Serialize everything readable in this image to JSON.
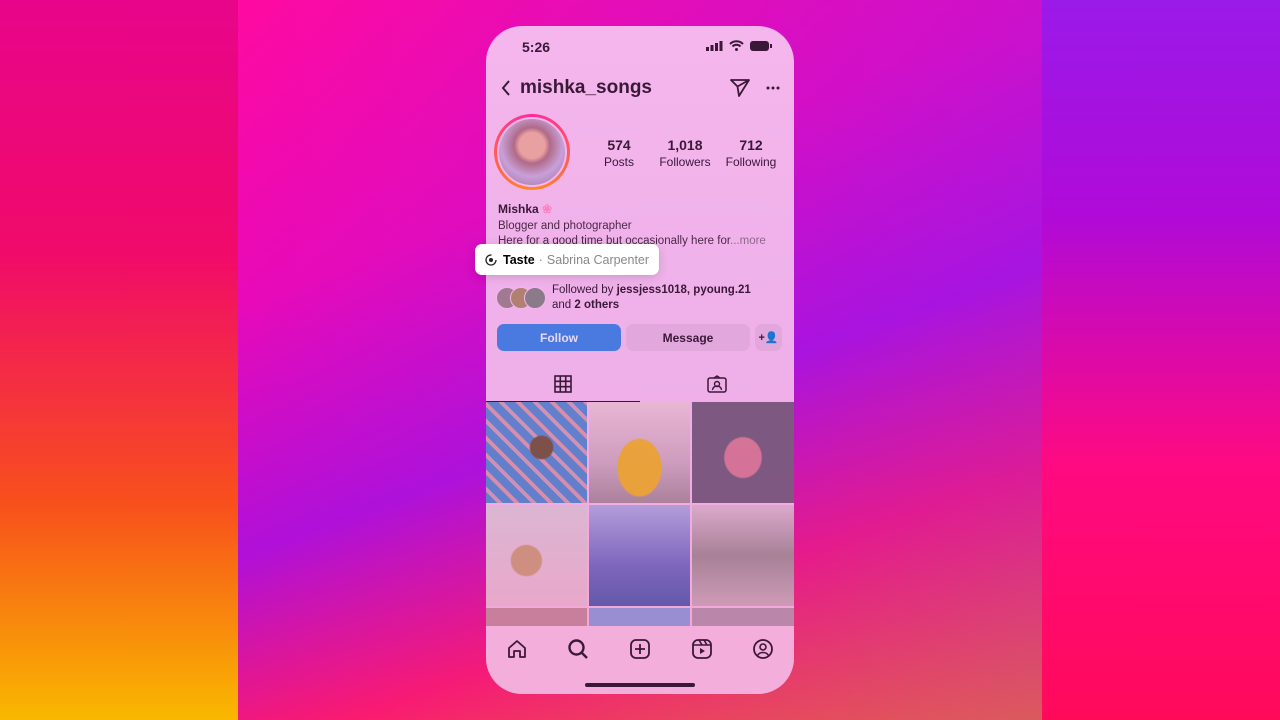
{
  "status": {
    "time": "5:26"
  },
  "header": {
    "username": "mishka_songs"
  },
  "stats": [
    {
      "value": "574",
      "label": "Posts"
    },
    {
      "value": "1,018",
      "label": "Followers"
    },
    {
      "value": "712",
      "label": "Following"
    }
  ],
  "profile": {
    "name": "Mishka",
    "bio_line1": "Blogger and photographer",
    "bio_line2": "Here for a good time but occasionally here for",
    "more": "...more"
  },
  "music": {
    "song": "Taste",
    "separator": "·",
    "artist": "Sabrina Carpenter"
  },
  "followed": {
    "prefix": "Followed by ",
    "names": "jessjess1018, pyoung.21",
    "and": "and ",
    "others": "2 others"
  },
  "buttons": {
    "follow": "Follow",
    "message": "Message",
    "add": "+👤"
  },
  "colors": {
    "accent": "#4a7ae0"
  }
}
